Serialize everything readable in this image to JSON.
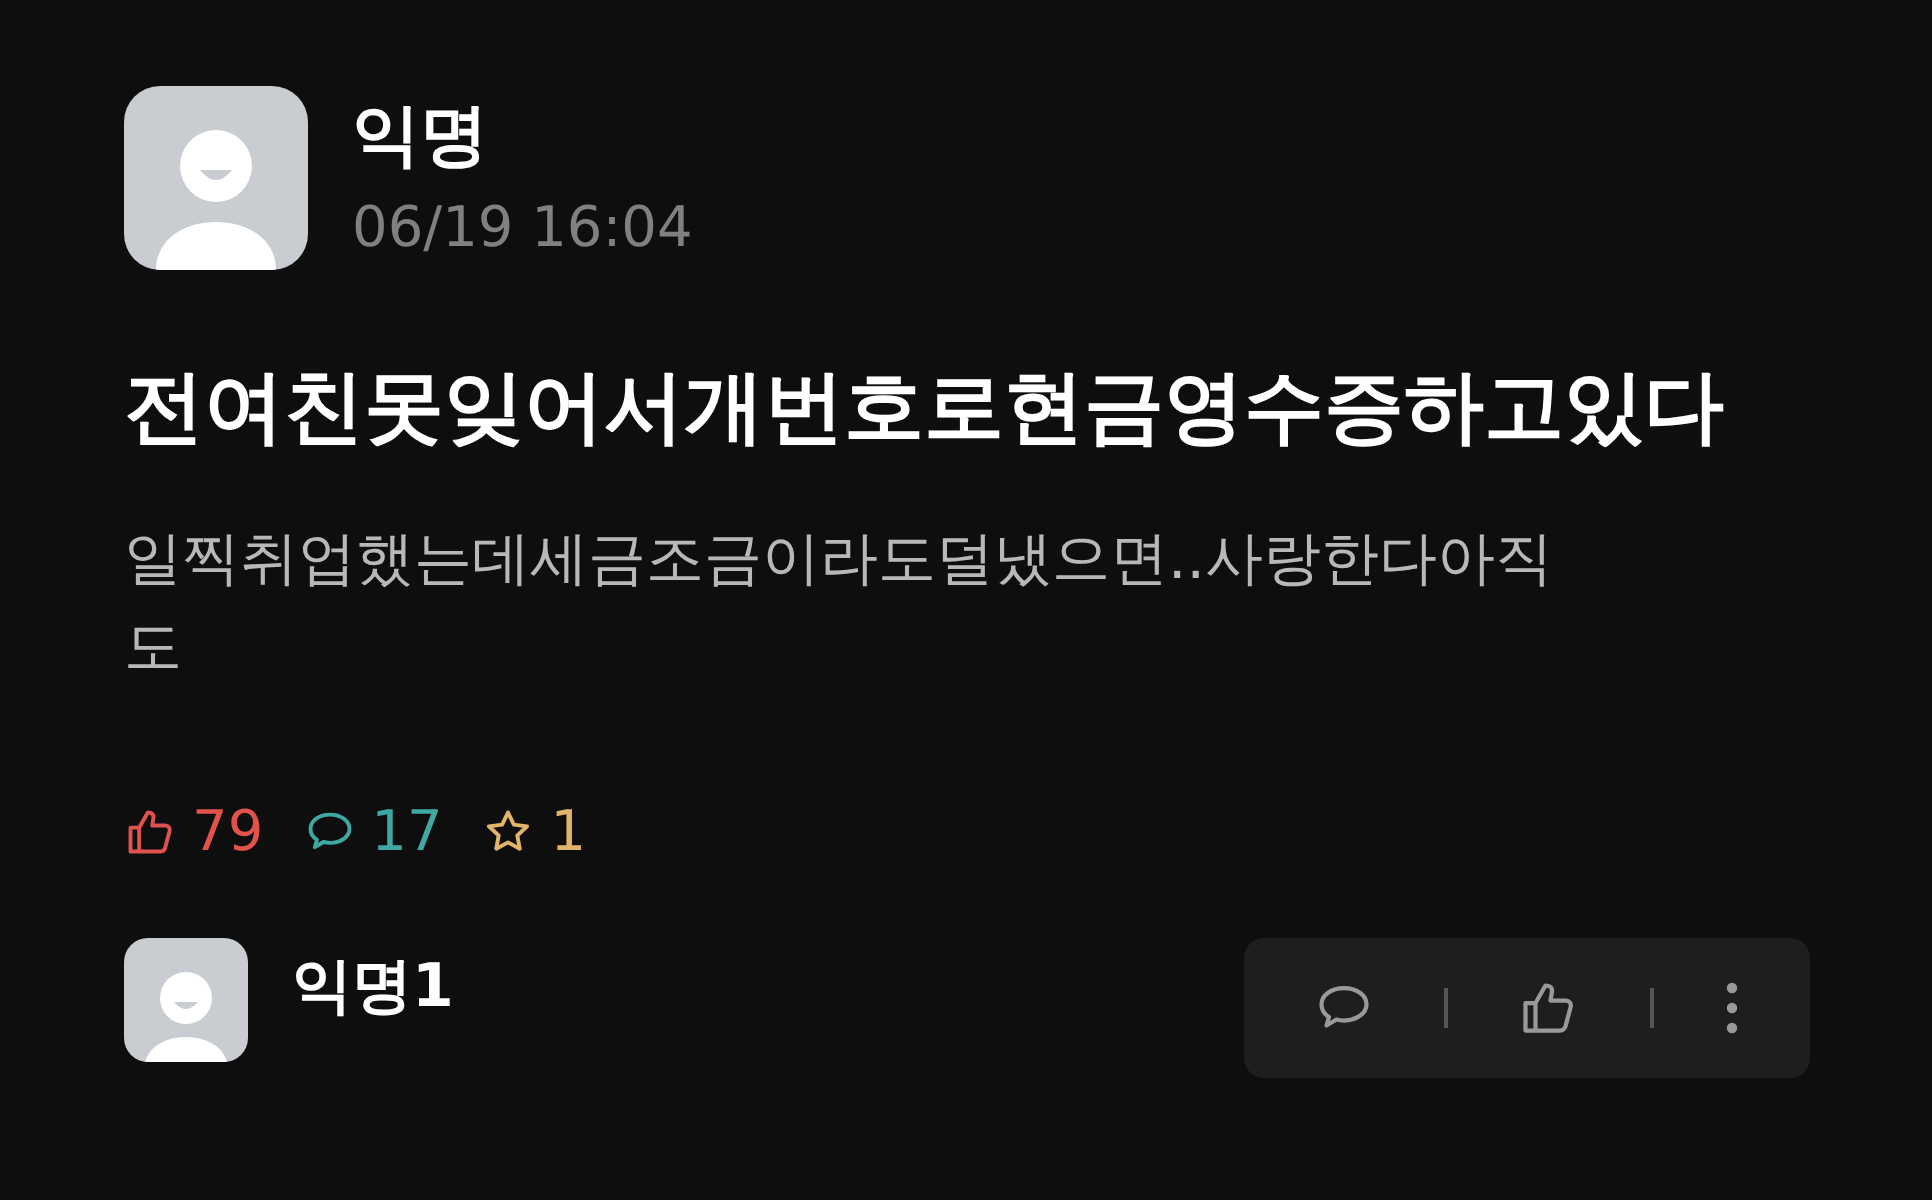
{
  "post": {
    "author": "익명",
    "time": "06/19 16:04",
    "title": "전여친못잊어서개번호로현금영수증하고있다",
    "body": "일찍취업했는데세금조금이라도덜냈으면..사랑한다아직도",
    "stats": [
      {
        "kind": "like",
        "count": "79",
        "color": "#e0534d"
      },
      {
        "kind": "comment",
        "count": "17",
        "color": "#3fa8a2"
      },
      {
        "kind": "scrap",
        "count": "1",
        "color": "#e2b46a"
      }
    ]
  },
  "comments": [
    {
      "author": "익명1",
      "actions": [
        {
          "kind": "reply"
        },
        {
          "kind": "like"
        },
        {
          "kind": "more"
        }
      ]
    }
  ]
}
